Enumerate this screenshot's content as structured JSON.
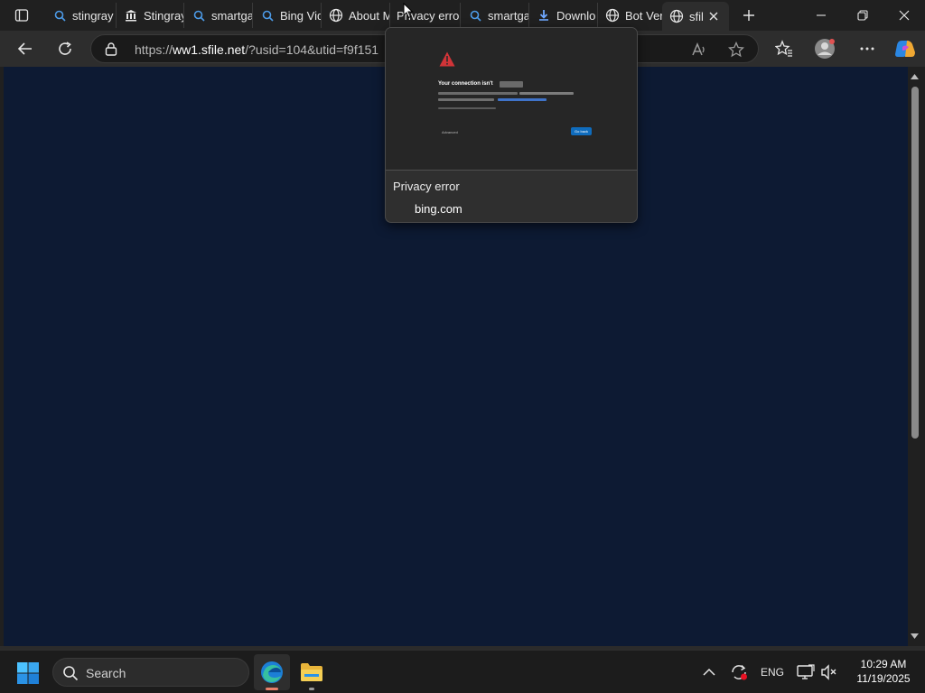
{
  "tabs": [
    {
      "label": "stingray",
      "icon": "search-icon"
    },
    {
      "label": "Stingray",
      "icon": "building-icon"
    },
    {
      "label": "smartga",
      "icon": "search-icon"
    },
    {
      "label": "Bing Vid",
      "icon": "search-icon"
    },
    {
      "label": "About M",
      "icon": "globe-icon"
    },
    {
      "label": "Privacy error",
      "icon": "none"
    },
    {
      "label": "smartga",
      "icon": "search-icon"
    },
    {
      "label": "Downlo",
      "icon": "download-icon"
    },
    {
      "label": "Bot Ver",
      "icon": "globe-icon"
    },
    {
      "label": "sfil",
      "icon": "globe-icon",
      "active": true
    }
  ],
  "address": {
    "scheme": "https://",
    "host": "ww1.sfile.net",
    "rest": "/?usid=104&utid=f9f151"
  },
  "preview": {
    "title": "Privacy error",
    "domain": "bing.com",
    "thumb_heading": "Your connection isn't",
    "thumb_advanced": "Advanced",
    "thumb_back": "Go back"
  },
  "taskbar": {
    "search_placeholder": "Search",
    "language": "ENG",
    "time": "10:29 AM",
    "date": "11/19/2025"
  },
  "colors": {
    "content_bg": "#0d1a33",
    "accent": "#0f6cbd",
    "warning": "#d13438"
  }
}
